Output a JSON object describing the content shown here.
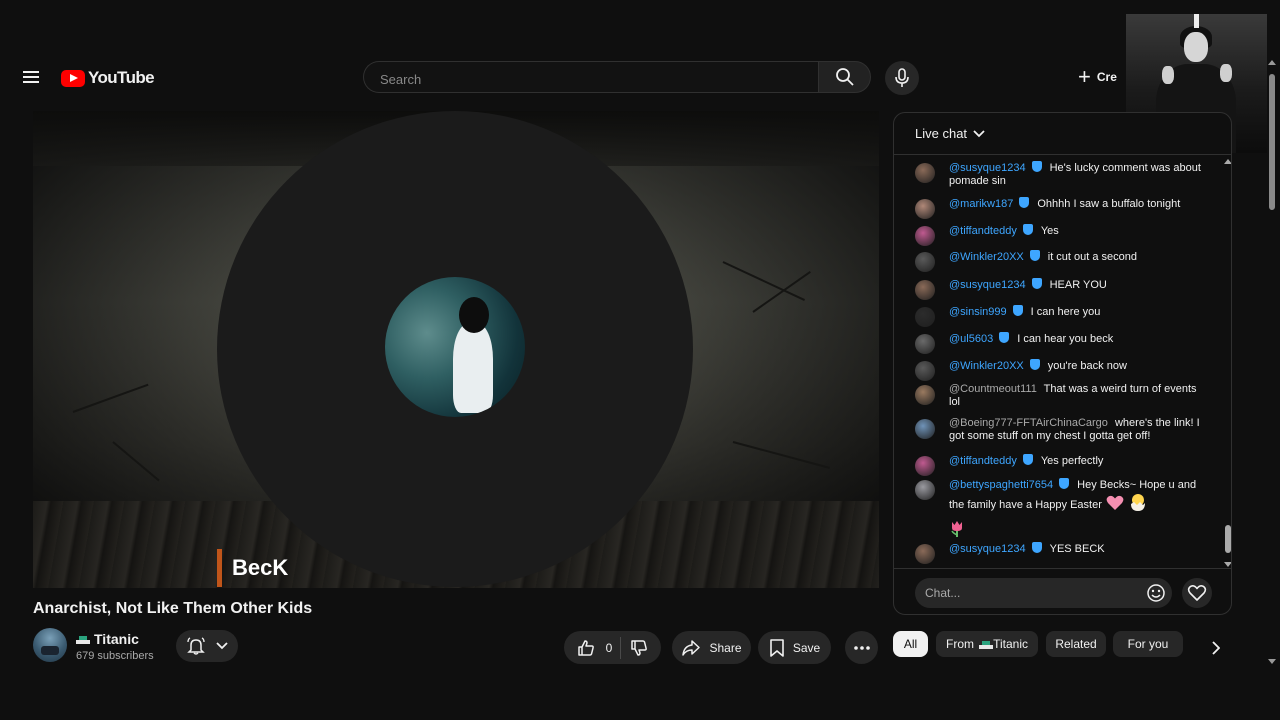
{
  "header": {
    "logo_text": "YouTube",
    "search_placeholder": "Search",
    "create_label": "Cre",
    "icons": {
      "menu": "menu-icon",
      "search": "search-icon",
      "mic": "mic-icon",
      "create": "plus-icon"
    }
  },
  "player": {
    "artist_overlay": "BecK"
  },
  "video": {
    "title": "Anarchist, Not Like Them Other Kids",
    "channel_name": "Titanic",
    "subscribers": "679 subscribers",
    "like_count": "0",
    "share_label": "Share",
    "save_label": "Save"
  },
  "chat": {
    "title": "Live chat",
    "input_placeholder": "Chat...",
    "messages": [
      {
        "user": "@susyque1234",
        "verified": true,
        "text": "He's lucky comment was about pomade sin",
        "avatar_color": "#8a6a58"
      },
      {
        "user": "@marikw187",
        "verified": true,
        "text": "Ohhhh I saw a buffalo tonight",
        "avatar_color": "#b08878"
      },
      {
        "user": "@tiffandteddy",
        "verified": true,
        "text": "Yes",
        "avatar_color": "#c05a90"
      },
      {
        "user": "@Winkler20XX",
        "verified": true,
        "text": "it cut out a second",
        "avatar_color": "#5a5a5a"
      },
      {
        "user": "@susyque1234",
        "verified": true,
        "text": "HEAR YOU",
        "avatar_color": "#8a6a58"
      },
      {
        "user": "@sinsin999",
        "verified": true,
        "text": "I can here you",
        "avatar_color": "#2c2c2c"
      },
      {
        "user": "@ul5603",
        "verified": true,
        "text": "I can hear you beck",
        "avatar_color": "#6a6a6a"
      },
      {
        "user": "@Winkler20XX",
        "verified": true,
        "text": "you're back now",
        "avatar_color": "#5a5a5a"
      },
      {
        "user": "@Countmeout111",
        "verified": false,
        "text": "That was a weird turn of events lol",
        "avatar_color": "#9a7a60"
      },
      {
        "user": "@Boeing777-FFTAirChinaCargo",
        "verified": false,
        "text": "where's the link! I got some stuff on my chest I gotta get off!",
        "avatar_color": "#6f93b8"
      },
      {
        "user": "@tiffandteddy",
        "verified": true,
        "text": "Yes perfectly",
        "avatar_color": "#c05a90"
      },
      {
        "user": "@bettyspaghetti7654",
        "verified": true,
        "text": "Hey Becks~ Hope u and the family have a Happy Easter",
        "avatar_color": "#9a9aa0"
      },
      {
        "user": "@susyque1234",
        "verified": true,
        "text": "YES BECK",
        "avatar_color": "#8a6a58"
      }
    ]
  },
  "chips": [
    {
      "label": "All",
      "active": true
    },
    {
      "label": "From",
      "suffix": "Titanic",
      "active": false
    },
    {
      "label": "Related",
      "active": false
    },
    {
      "label": "For you",
      "active": false
    }
  ],
  "colors": {
    "background": "#0f0f0f",
    "accent_red": "#ff0000",
    "link_blue": "#3ea6ff",
    "chip_bg": "#272727"
  }
}
